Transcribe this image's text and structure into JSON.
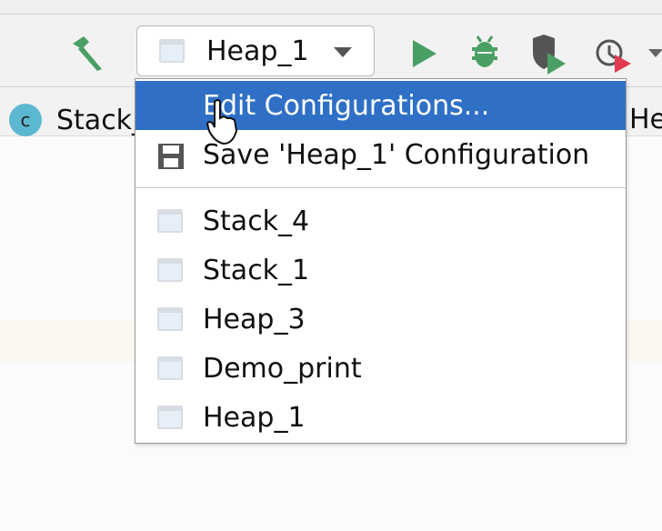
{
  "toolbar": {
    "run_config": "Heap_1",
    "icons": [
      "hammer-icon",
      "run-icon",
      "debug-icon",
      "coverage-icon",
      "profile-icon"
    ]
  },
  "tabs": [
    {
      "label": "Stack_"
    },
    {
      "label": "He"
    }
  ],
  "popup": {
    "edit_label": "Edit Configurations...",
    "save_label": "Save 'Heap_1' Configuration",
    "configs": [
      "Stack_4",
      "Stack_1",
      "Heap_3",
      "Demo_print",
      "Heap_1"
    ]
  },
  "colors": {
    "selection": "#2f70c6",
    "green": "#4aa064"
  }
}
